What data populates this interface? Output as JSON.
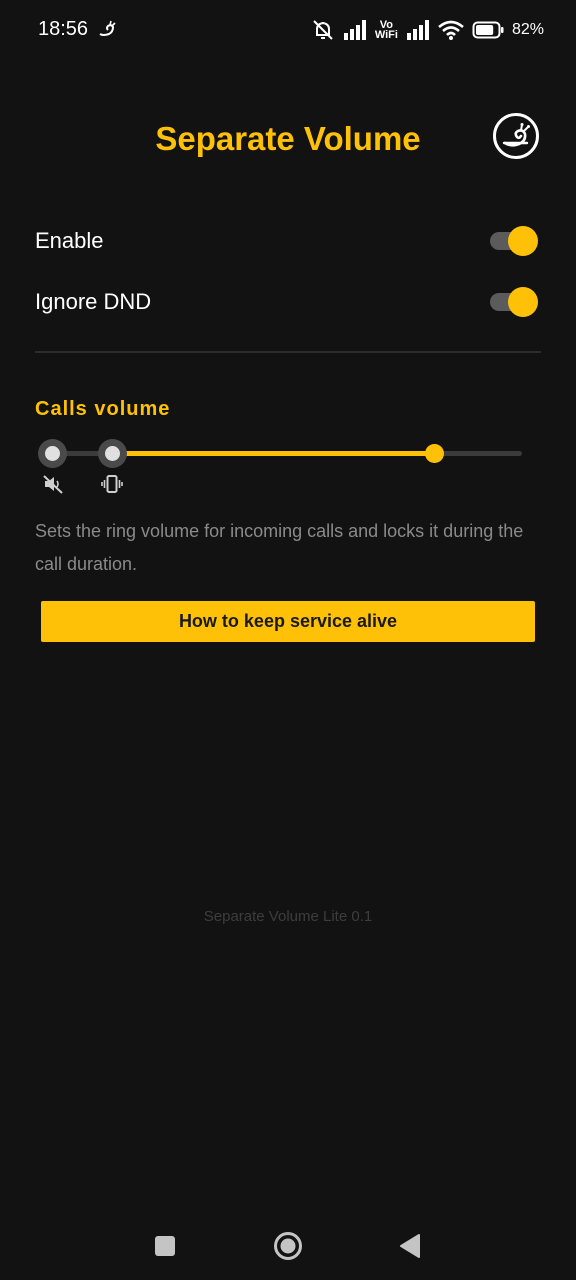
{
  "status_bar": {
    "time": "18:56",
    "volte_line1": "Vo",
    "volte_line2": "WiFi",
    "battery_percent": "82%",
    "battery_level": 0.82,
    "icons": [
      "app-notification-icon",
      "bell-off-icon",
      "signal-icon",
      "vowifi-icon",
      "signal-icon",
      "wifi-icon",
      "battery-icon"
    ]
  },
  "header": {
    "title": "Separate Volume",
    "about_icon": "snail-logo-icon"
  },
  "settings": [
    {
      "label": "Enable",
      "enabled": true
    },
    {
      "label": "Ignore DND",
      "enabled": true
    }
  ],
  "calls_volume": {
    "title": "Calls volume",
    "level_fraction": 0.785,
    "stop_icons": [
      "mute-icon",
      "vibrate-icon"
    ],
    "description": "Sets the ring volume for incoming calls and locks it during the call duration."
  },
  "action_button": {
    "label": "How to keep service alive"
  },
  "footer": {
    "version": "Separate Volume Lite 0.1"
  },
  "nav": {
    "icons": [
      "recents-icon",
      "home-icon",
      "back-icon"
    ]
  },
  "colors": {
    "accent": "#FFC107",
    "background": "#121212",
    "text_secondary": "#8a8a8a"
  }
}
